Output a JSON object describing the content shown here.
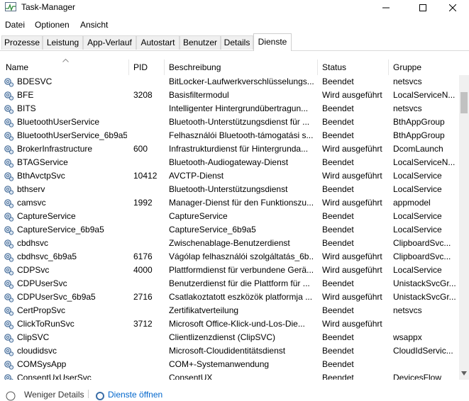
{
  "window": {
    "title": "Task-Manager"
  },
  "menu": [
    "Datei",
    "Optionen",
    "Ansicht"
  ],
  "tabs": [
    "Prozesse",
    "Leistung",
    "App-Verlauf",
    "Autostart",
    "Benutzer",
    "Details",
    "Dienste"
  ],
  "columns": {
    "name": "Name",
    "pid": "PID",
    "description": "Beschreibung",
    "status": "Status",
    "group": "Gruppe"
  },
  "rows": [
    {
      "name": "BDESVC",
      "pid": "",
      "desc": "BitLocker-Laufwerkverschlüsselungs...",
      "status": "Beendet",
      "group": "netsvcs"
    },
    {
      "name": "BFE",
      "pid": "3208",
      "desc": "Basisfiltermodul",
      "status": "Wird ausgeführt",
      "group": "LocalServiceN..."
    },
    {
      "name": "BITS",
      "pid": "",
      "desc": "Intelligenter Hintergrundübertragun...",
      "status": "Beendet",
      "group": "netsvcs"
    },
    {
      "name": "BluetoothUserService",
      "pid": "",
      "desc": "Bluetooth-Unterstützungsdienst für ...",
      "status": "Beendet",
      "group": "BthAppGroup"
    },
    {
      "name": "BluetoothUserService_6b9a5",
      "pid": "",
      "desc": "Felhasználói Bluetooth-támogatási s...",
      "status": "Beendet",
      "group": "BthAppGroup"
    },
    {
      "name": "BrokerInfrastructure",
      "pid": "600",
      "desc": "Infrastrukturdienst für Hintergrunda...",
      "status": "Wird ausgeführt",
      "group": "DcomLaunch"
    },
    {
      "name": "BTAGService",
      "pid": "",
      "desc": "Bluetooth-Audiogateway-Dienst",
      "status": "Beendet",
      "group": "LocalServiceN..."
    },
    {
      "name": "BthAvctpSvc",
      "pid": "10412",
      "desc": "AVCTP-Dienst",
      "status": "Wird ausgeführt",
      "group": "LocalService"
    },
    {
      "name": "bthserv",
      "pid": "",
      "desc": "Bluetooth-Unterstützungsdienst",
      "status": "Beendet",
      "group": "LocalService"
    },
    {
      "name": "camsvc",
      "pid": "1992",
      "desc": "Manager-Dienst für den Funktionszu...",
      "status": "Wird ausgeführt",
      "group": "appmodel"
    },
    {
      "name": "CaptureService",
      "pid": "",
      "desc": "CaptureService",
      "status": "Beendet",
      "group": "LocalService"
    },
    {
      "name": "CaptureService_6b9a5",
      "pid": "",
      "desc": "CaptureService_6b9a5",
      "status": "Beendet",
      "group": "LocalService"
    },
    {
      "name": "cbdhsvc",
      "pid": "",
      "desc": "Zwischenablage-Benutzerdienst",
      "status": "Beendet",
      "group": "ClipboardSvc..."
    },
    {
      "name": "cbdhsvc_6b9a5",
      "pid": "6176",
      "desc": "Vágólap felhasználói szolgáltatás_6b...",
      "status": "Wird ausgeführt",
      "group": "ClipboardSvc..."
    },
    {
      "name": "CDPSvc",
      "pid": "4000",
      "desc": "Plattformdienst für verbundene Gerä...",
      "status": "Wird ausgeführt",
      "group": "LocalService"
    },
    {
      "name": "CDPUserSvc",
      "pid": "",
      "desc": "Benutzerdienst für die Plattform für ...",
      "status": "Beendet",
      "group": "UnistackSvcGr..."
    },
    {
      "name": "CDPUserSvc_6b9a5",
      "pid": "2716",
      "desc": "Csatlakoztatott eszközök platformja ...",
      "status": "Wird ausgeführt",
      "group": "UnistackSvcGr..."
    },
    {
      "name": "CertPropSvc",
      "pid": "",
      "desc": "Zertifikatverteilung",
      "status": "Beendet",
      "group": "netsvcs"
    },
    {
      "name": "ClickToRunSvc",
      "pid": "3712",
      "desc": "Microsoft Office-Klick-und-Los-Die...",
      "status": "Wird ausgeführt",
      "group": ""
    },
    {
      "name": "ClipSVC",
      "pid": "",
      "desc": "Clientlizenzdienst (ClipSVC)",
      "status": "Beendet",
      "group": "wsappx"
    },
    {
      "name": "cloudidsvc",
      "pid": "",
      "desc": "Microsoft-Cloudidentitätsdienst",
      "status": "Beendet",
      "group": "CloudIdServic..."
    },
    {
      "name": "COMSysApp",
      "pid": "",
      "desc": "COM+-Systemanwendung",
      "status": "Beendet",
      "group": ""
    },
    {
      "name": "ConsentUxUserSvc",
      "pid": "",
      "desc": "ConsentUX",
      "status": "Beendet",
      "group": "DevicesFlow"
    }
  ],
  "footer": {
    "less_details": "Weniger Details",
    "open_services": "Dienste öffnen"
  }
}
